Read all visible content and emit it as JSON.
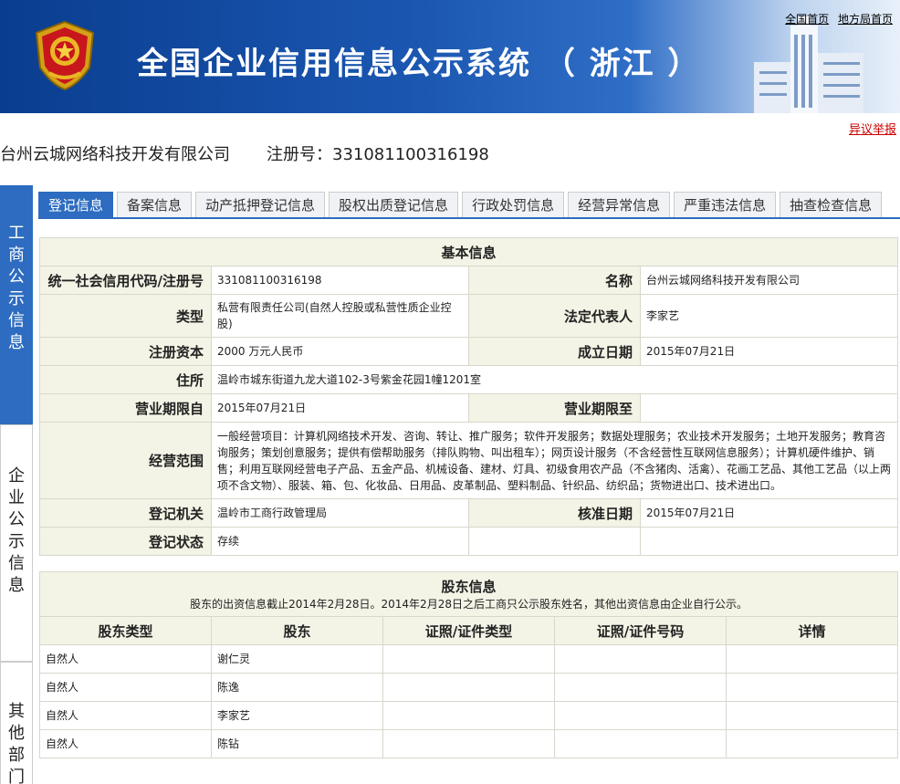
{
  "header": {
    "title": "全国企业信用信息公示系统 （ 浙江 ）",
    "links": [
      "全国首页",
      "地方局首页"
    ]
  },
  "objection_link": "异议举报",
  "company": {
    "name": "台州云城网络科技开发有限公司",
    "reg_label": "注册号：331081100316198"
  },
  "side_tabs": [
    "工商公示信息",
    "企业公示信息",
    "其他部门"
  ],
  "tabs": [
    "登记信息",
    "备案信息",
    "动产抵押登记信息",
    "股权出质登记信息",
    "行政处罚信息",
    "经营异常信息",
    "严重违法信息",
    "抽查检查信息"
  ],
  "basic": {
    "title": "基本信息",
    "credit_code_label": "统一社会信用代码/注册号",
    "credit_code": "331081100316198",
    "name_label": "名称",
    "name": "台州云城网络科技开发有限公司",
    "type_label": "类型",
    "type": "私营有限责任公司(自然人控股或私营性质企业控股)",
    "legal_rep_label": "法定代表人",
    "legal_rep": "李家艺",
    "capital_label": "注册资本",
    "capital": "2000 万元人民币",
    "established_label": "成立日期",
    "established": "2015年07月21日",
    "address_label": "住所",
    "address": "温岭市城东街道九龙大道102-3号紫金花园1幢1201室",
    "term_from_label": "营业期限自",
    "term_from": "2015年07月21日",
    "term_to_label": "营业期限至",
    "term_to": "",
    "scope_label": "经营范围",
    "scope": "一般经营项目：计算机网络技术开发、咨询、转让、推广服务；软件开发服务；数据处理服务；农业技术开发服务；土地开发服务；教育咨询服务；策划创意服务；提供有偿帮助服务（排队购物、叫出租车）；网页设计服务（不含经营性互联网信息服务）；计算机硬件维护、销售；利用互联网经营电子产品、五金产品、机械设备、建材、灯具、初级食用农产品（不含猪肉、活禽）、花画工艺品、其他工艺品（以上两项不含文物）、服装、箱、包、化妆品、日用品、皮革制品、塑料制品、针织品、纺织品；货物进出口、技术进出口。",
    "authority_label": "登记机关",
    "authority": "温岭市工商行政管理局",
    "approved_label": "核准日期",
    "approved": "2015年07月21日",
    "status_label": "登记状态",
    "status": "存续"
  },
  "shareholders": {
    "title": "股东信息",
    "note": "股东的出资信息截止2014年2月28日。2014年2月28日之后工商只公示股东姓名，其他出资信息由企业自行公示。",
    "columns": [
      "股东类型",
      "股东",
      "证照/证件类型",
      "证照/证件号码",
      "详情"
    ],
    "rows": [
      [
        "自然人",
        "谢仁灵",
        "",
        "",
        ""
      ],
      [
        "自然人",
        "陈逸",
        "",
        "",
        ""
      ],
      [
        "自然人",
        "李家艺",
        "",
        "",
        ""
      ],
      [
        "自然人",
        "陈钻",
        "",
        "",
        ""
      ]
    ]
  },
  "colors": {
    "accent": "#2d6cc0",
    "label_bg": "#f3f3e6",
    "link_red": "#cc0000"
  }
}
